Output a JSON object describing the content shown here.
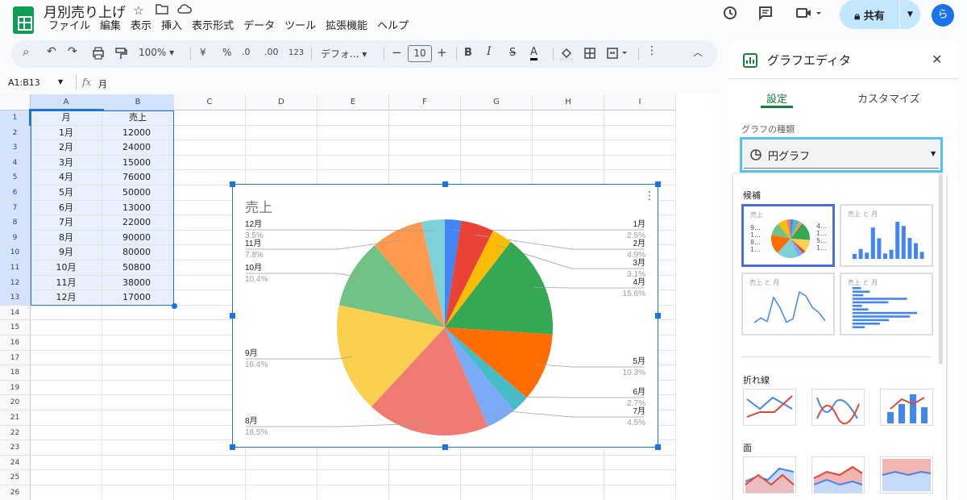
{
  "doc": {
    "title": "月別売り上げ"
  },
  "menu": [
    "ファイル",
    "編集",
    "表示",
    "挿入",
    "表示形式",
    "データ",
    "ツール",
    "拡張機能",
    "ヘルプ"
  ],
  "share": {
    "label": "共有"
  },
  "avatar": {
    "letter": "ら"
  },
  "toolbar": {
    "zoom": "100%",
    "currency": "¥",
    "percent": "%",
    "dec_down": ".0",
    "dec_up": ".00",
    "number_format": "123",
    "font": "デフォ...",
    "font_size": "10",
    "minus": "−",
    "plus": "+",
    "bold": "B",
    "italic": "I",
    "strike": "S",
    "text_color": "A"
  },
  "formula": {
    "range": "A1:B13",
    "fx": "fx",
    "value": "月"
  },
  "sheet": {
    "columns": [
      "A",
      "B",
      "C",
      "D",
      "E",
      "F",
      "G",
      "H",
      "I"
    ],
    "rows": [
      "1",
      "2",
      "3",
      "4",
      "5",
      "6",
      "7",
      "8",
      "9",
      "10",
      "11",
      "12",
      "13",
      "14",
      "15",
      "16",
      "17",
      "18",
      "19",
      "20",
      "21",
      "22",
      "23",
      "24",
      "25",
      "26"
    ],
    "header": [
      "月",
      "売上"
    ],
    "data": [
      [
        "1月",
        "12000"
      ],
      [
        "2月",
        "24000"
      ],
      [
        "3月",
        "15000"
      ],
      [
        "4月",
        "76000"
      ],
      [
        "5月",
        "50000"
      ],
      [
        "6月",
        "13000"
      ],
      [
        "7月",
        "22000"
      ],
      [
        "8月",
        "90000"
      ],
      [
        "9月",
        "80000"
      ],
      [
        "10月",
        "50800"
      ],
      [
        "11月",
        "38000"
      ],
      [
        "12月",
        "17000"
      ]
    ]
  },
  "chart_data": {
    "type": "pie",
    "title": "売上",
    "categories": [
      "1月",
      "2月",
      "3月",
      "4月",
      "5月",
      "6月",
      "7月",
      "8月",
      "9月",
      "10月",
      "11月",
      "12月"
    ],
    "values": [
      12000,
      24000,
      15000,
      76000,
      50000,
      13000,
      22000,
      90000,
      80000,
      50800,
      38000,
      17000
    ],
    "percent_labels": [
      "2.5%",
      "4.9%",
      "3.1%",
      "15.6%",
      "10.3%",
      "2.7%",
      "4.5%",
      "18.5%",
      "16.4%",
      "10.4%",
      "7.8%",
      "3.5%"
    ],
    "colors": [
      "#4285f4",
      "#ea4335",
      "#fbbc04",
      "#34a853",
      "#ff6d01",
      "#46bdc6",
      "#7baaf7",
      "#f07b72",
      "#fcd04f",
      "#71c287",
      "#ff994d",
      "#7ed1d7"
    ]
  },
  "editor": {
    "title": "グラフエディタ",
    "tab_setup": "設定",
    "tab_customize": "カスタマイズ",
    "chart_type_label": "グラフの種類",
    "chart_type_value": "円グラフ",
    "suggested": "候補",
    "thumb1": "売上",
    "thumb2": "売上 と 月",
    "thumb3": "売上 と 月",
    "thumb4": "売上 と 月",
    "section_line": "折れ線",
    "section_area": "面"
  }
}
